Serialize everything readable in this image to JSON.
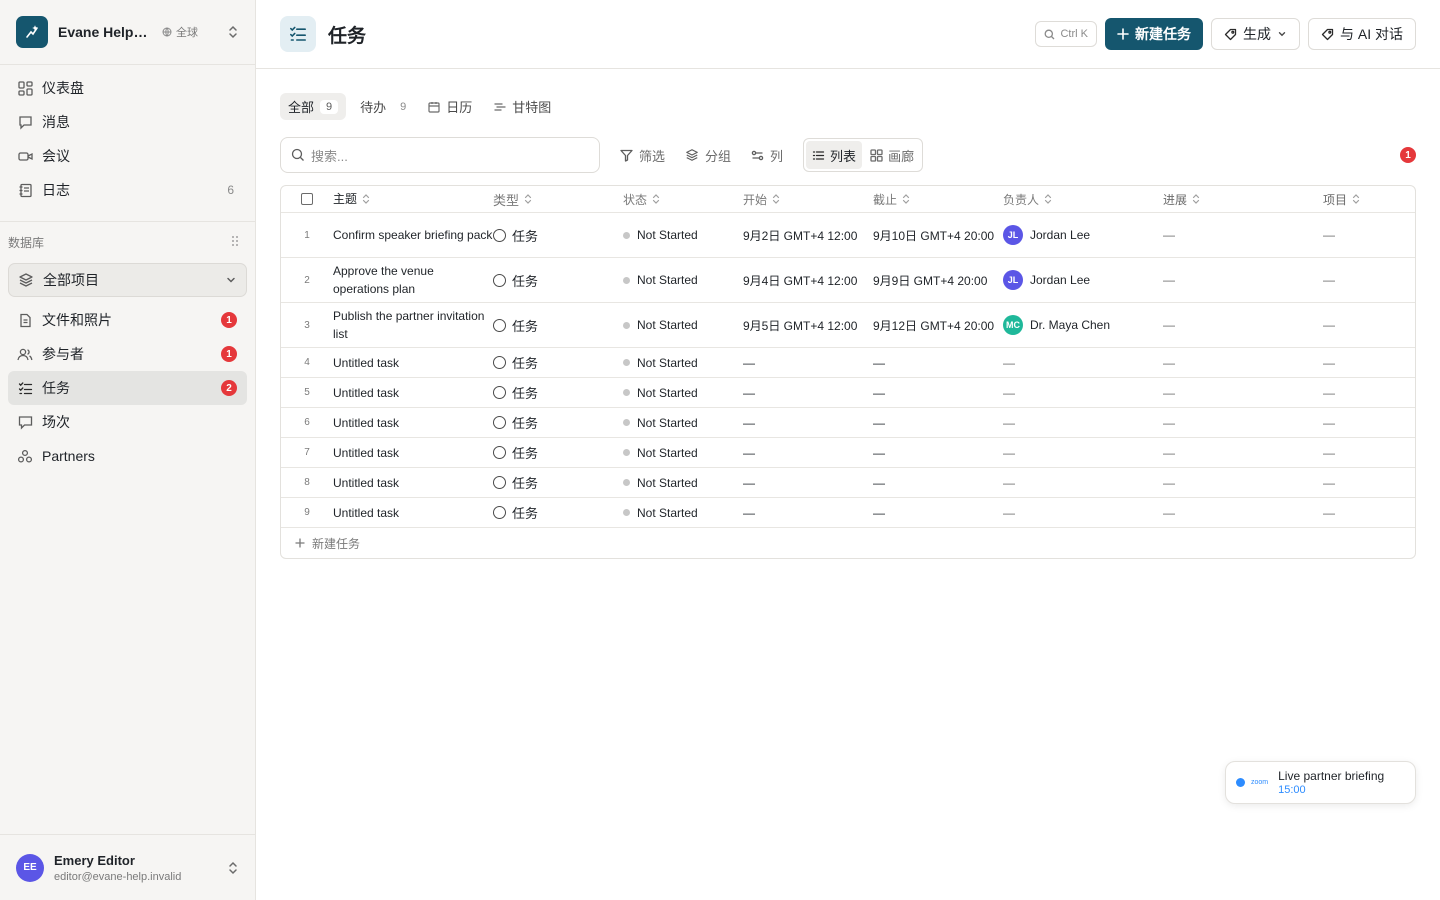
{
  "workspace": {
    "name": "Evane Help Center",
    "region": "全球"
  },
  "nav": {
    "items": [
      {
        "label": "仪表盘",
        "icon": "dashboard-icon"
      },
      {
        "label": "消息",
        "icon": "message-icon"
      },
      {
        "label": "会议",
        "icon": "video-icon"
      },
      {
        "label": "日志",
        "icon": "log-icon",
        "count": "6"
      }
    ]
  },
  "database": {
    "section_label": "数据库",
    "project_select": "全部项目",
    "items": [
      {
        "label": "文件和照片",
        "badge": "1"
      },
      {
        "label": "参与者",
        "badge": "1"
      },
      {
        "label": "任务",
        "badge": "2"
      },
      {
        "label": "场次"
      },
      {
        "label": "Partners"
      }
    ]
  },
  "user": {
    "initials": "EE",
    "name": "Emery Editor",
    "email": "editor@evane-help.invalid"
  },
  "page": {
    "title": "任务",
    "shortcut": "Ctrl K",
    "new_task_label": "新建任务",
    "generate_label": "生成",
    "ai_chat_label": "与 AI 对话"
  },
  "tabs": [
    {
      "label": "全部",
      "count": "9"
    },
    {
      "label": "待办",
      "count": "9"
    },
    {
      "label": "日历"
    },
    {
      "label": "甘特图"
    }
  ],
  "toolbar": {
    "search_placeholder": "搜索...",
    "filter_label": "筛选",
    "group_label": "分组",
    "columns_label": "列",
    "list_label": "列表",
    "gallery_label": "画廊",
    "notification_count": "1"
  },
  "table": {
    "columns": [
      "主题",
      "类型",
      "状态",
      "开始",
      "截止",
      "负责人",
      "进展",
      "项目"
    ],
    "rows": [
      {
        "idx": "1",
        "subject": "Confirm speaker briefing pack",
        "type": "任务",
        "status": "Not Started",
        "start": "9月2日 GMT+4 12:00",
        "end": "9月10日 GMT+4 20:00",
        "owner": "Jordan Lee",
        "owner_initials": "JL",
        "owner_color": "#5b56e6",
        "progress": "—",
        "project": "—"
      },
      {
        "idx": "2",
        "subject": "Approve the venue operations plan",
        "type": "任务",
        "status": "Not Started",
        "start": "9月4日 GMT+4 12:00",
        "end": "9月9日 GMT+4 20:00",
        "owner": "Jordan Lee",
        "owner_initials": "JL",
        "owner_color": "#5b56e6",
        "progress": "—",
        "project": "—"
      },
      {
        "idx": "3",
        "subject": "Publish the partner invitation list",
        "type": "任务",
        "status": "Not Started",
        "start": "9月5日 GMT+4 12:00",
        "end": "9月12日 GMT+4 20:00",
        "owner": "Dr. Maya Chen",
        "owner_initials": "MC",
        "owner_color": "#1fb89a",
        "progress": "—",
        "project": "—"
      },
      {
        "idx": "4",
        "subject": "Untitled task",
        "type": "任务",
        "status": "Not Started",
        "start": "—",
        "end": "—",
        "owner": "—",
        "progress": "—",
        "project": "—"
      },
      {
        "idx": "5",
        "subject": "Untitled task",
        "type": "任务",
        "status": "Not Started",
        "start": "—",
        "end": "—",
        "owner": "—",
        "progress": "—",
        "project": "—"
      },
      {
        "idx": "6",
        "subject": "Untitled task",
        "type": "任务",
        "status": "Not Started",
        "start": "—",
        "end": "—",
        "owner": "—",
        "progress": "—",
        "project": "—"
      },
      {
        "idx": "7",
        "subject": "Untitled task",
        "type": "任务",
        "status": "Not Started",
        "start": "—",
        "end": "—",
        "owner": "—",
        "progress": "—",
        "project": "—"
      },
      {
        "idx": "8",
        "subject": "Untitled task",
        "type": "任务",
        "status": "Not Started",
        "start": "—",
        "end": "—",
        "owner": "—",
        "progress": "—",
        "project": "—"
      },
      {
        "idx": "9",
        "subject": "Untitled task",
        "type": "任务",
        "status": "Not Started",
        "start": "—",
        "end": "—",
        "owner": "—",
        "progress": "—",
        "project": "—"
      }
    ],
    "add_row_label": "新建任务"
  },
  "meeting": {
    "brand": "zoom",
    "title": "Live partner briefing",
    "time": "15:00"
  },
  "colors": {
    "accent": "#15566e",
    "badge": "#e5383b",
    "zoom": "#2d8cff"
  }
}
